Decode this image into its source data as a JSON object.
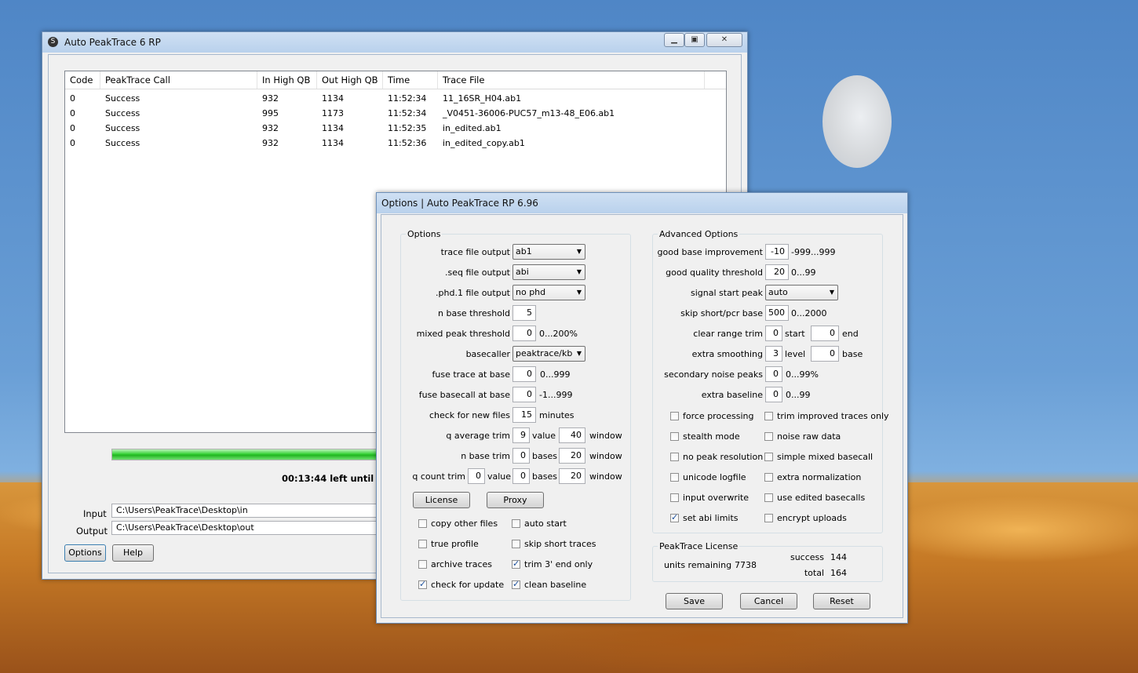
{
  "main": {
    "title": "Auto PeakTrace 6 RP",
    "controls": {
      "minimize": "▁",
      "maximize": "▣",
      "close": "✕"
    },
    "columns": [
      "Code",
      "PeakTrace Call",
      "In High QB",
      "Out High QB",
      "Time",
      "Trace File"
    ],
    "rows": [
      [
        "0",
        "Success",
        "932",
        "1134",
        "11:52:34",
        "11_16SR_H04.ab1"
      ],
      [
        "0",
        "Success",
        "995",
        "1173",
        "11:52:34",
        "_V0451-36006-PUC57_m13-48_E06.ab1"
      ],
      [
        "0",
        "Success",
        "932",
        "1134",
        "11:52:35",
        "in_edited.ab1"
      ],
      [
        "0",
        "Success",
        "932",
        "1134",
        "11:52:36",
        "in_edited_copy.ab1"
      ]
    ],
    "progress": 0.6,
    "countdown": "00:13:44 left until nex",
    "input_label": "Input",
    "input_value": "C:\\Users\\PeakTrace\\Desktop\\in",
    "output_label": "Output",
    "output_value": "C:\\Users\\PeakTrace\\Desktop\\out",
    "options_button": "Options",
    "help_button": "Help"
  },
  "options": {
    "title": "Options | Auto PeakTrace RP 6.96",
    "group_title": "Options",
    "trace_file_output": {
      "label": "trace file output",
      "value": "ab1"
    },
    "seq_file_output": {
      "label": ".seq file output",
      "value": "abi"
    },
    "phd_file_output": {
      "label": ".phd.1 file output",
      "value": "no phd"
    },
    "n_base_threshold": {
      "label": "n base threshold",
      "value": "5"
    },
    "mixed_peak_threshold": {
      "label": "mixed peak threshold",
      "value": "0",
      "unit": "0...200%"
    },
    "basecaller": {
      "label": "basecaller",
      "value": "peaktrace/kb"
    },
    "fuse_trace": {
      "label": "fuse trace at base",
      "value": "0",
      "unit": "0...999"
    },
    "fuse_basecall": {
      "label": "fuse basecall at base",
      "value": "0",
      "unit": "-1...999"
    },
    "check_new_files": {
      "label": "check for new files",
      "value": "15",
      "unit": "minutes"
    },
    "q_average_trim": {
      "label": "q average trim",
      "value1": "9",
      "unit1": "value",
      "value2": "40",
      "unit2": "window"
    },
    "n_base_trim": {
      "label": "n base trim",
      "value1": "0",
      "unit1": "bases",
      "value2": "20",
      "unit2": "window"
    },
    "q_count_trim": {
      "label": "q count trim",
      "value1": "0",
      "unit1": "value",
      "value2": "0",
      "unit2": "bases",
      "value3": "20",
      "unit3": "window"
    },
    "license_button": "License",
    "proxy_button": "Proxy",
    "checks": [
      {
        "label": "copy other files",
        "checked": false
      },
      {
        "label": "auto start",
        "checked": false
      },
      {
        "label": "true profile",
        "checked": false
      },
      {
        "label": "skip short traces",
        "checked": false
      },
      {
        "label": "archive traces",
        "checked": false
      },
      {
        "label": "trim 3' end only",
        "checked": true
      },
      {
        "label": "check for update",
        "checked": true
      },
      {
        "label": "clean baseline",
        "checked": true
      }
    ]
  },
  "advanced": {
    "group_title": "Advanced Options",
    "good_base_improvement": {
      "label": "good base improvement",
      "value": "-10",
      "unit": "-999...999"
    },
    "good_quality_threshold": {
      "label": "good quality threshold",
      "value": "20",
      "unit": "0...99"
    },
    "signal_start_peak": {
      "label": "signal start peak",
      "value": "auto"
    },
    "skip_short_pcr": {
      "label": "skip short/pcr base",
      "value": "500",
      "unit": "0...2000"
    },
    "clear_range_trim": {
      "label": "clear range trim",
      "value1": "0",
      "unit1": "start",
      "value2": "0",
      "unit2": "end"
    },
    "extra_smoothing": {
      "label": "extra smoothing",
      "value1": "3",
      "unit1": "level",
      "value2": "0",
      "unit2": "base"
    },
    "secondary_noise_peaks": {
      "label": "secondary noise peaks",
      "value": "0",
      "unit": "0...99%"
    },
    "extra_baseline": {
      "label": "extra baseline",
      "value": "0",
      "unit": "0...99"
    },
    "checks": [
      {
        "label": "force processing",
        "checked": false
      },
      {
        "label": "trim improved traces only",
        "checked": false
      },
      {
        "label": "stealth mode",
        "checked": false
      },
      {
        "label": "noise raw data",
        "checked": false
      },
      {
        "label": "no peak resolution",
        "checked": false
      },
      {
        "label": "simple mixed basecall",
        "checked": false
      },
      {
        "label": "unicode logfile",
        "checked": false
      },
      {
        "label": "extra normalization",
        "checked": false
      },
      {
        "label": "input overwrite",
        "checked": false
      },
      {
        "label": "use edited basecalls",
        "checked": false
      },
      {
        "label": "set abi limits",
        "checked": true
      },
      {
        "label": "encrypt uploads",
        "checked": false
      }
    ]
  },
  "license": {
    "group_title": "PeakTrace License",
    "units_label": "units remaining",
    "units_value": "7738",
    "success_label": "success",
    "success_value": "144",
    "total_label": "total",
    "total_value": "164"
  },
  "footer": {
    "save": "Save",
    "cancel": "Cancel",
    "reset": "Reset"
  }
}
